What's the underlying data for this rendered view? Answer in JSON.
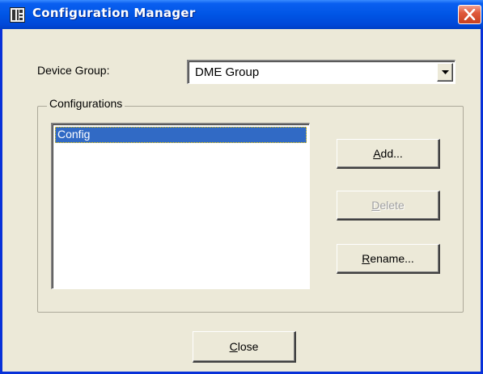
{
  "window": {
    "title": "Configuration Manager",
    "title_icon": "configuration-app-icon",
    "close_icon": "close-x-icon",
    "colors": {
      "titlebar": "#0055e5",
      "close_button": "#e05a3c",
      "face": "#ece9d8",
      "selection": "#316ac5"
    }
  },
  "device_group": {
    "label": "Device Group:",
    "selected_value": "DME Group",
    "arrow_icon": "dropdown-arrow-icon"
  },
  "configurations": {
    "group_title": "Configurations",
    "items": [
      {
        "label": "Config",
        "selected": true
      }
    ]
  },
  "buttons": {
    "add": {
      "mnemonic": "A",
      "rest": "dd...",
      "enabled": true
    },
    "delete": {
      "mnemonic": "D",
      "rest": "elete",
      "enabled": false
    },
    "rename": {
      "mnemonic": "R",
      "rest": "ename...",
      "enabled": true
    },
    "close": {
      "mnemonic": "C",
      "rest": "lose",
      "enabled": true
    }
  }
}
